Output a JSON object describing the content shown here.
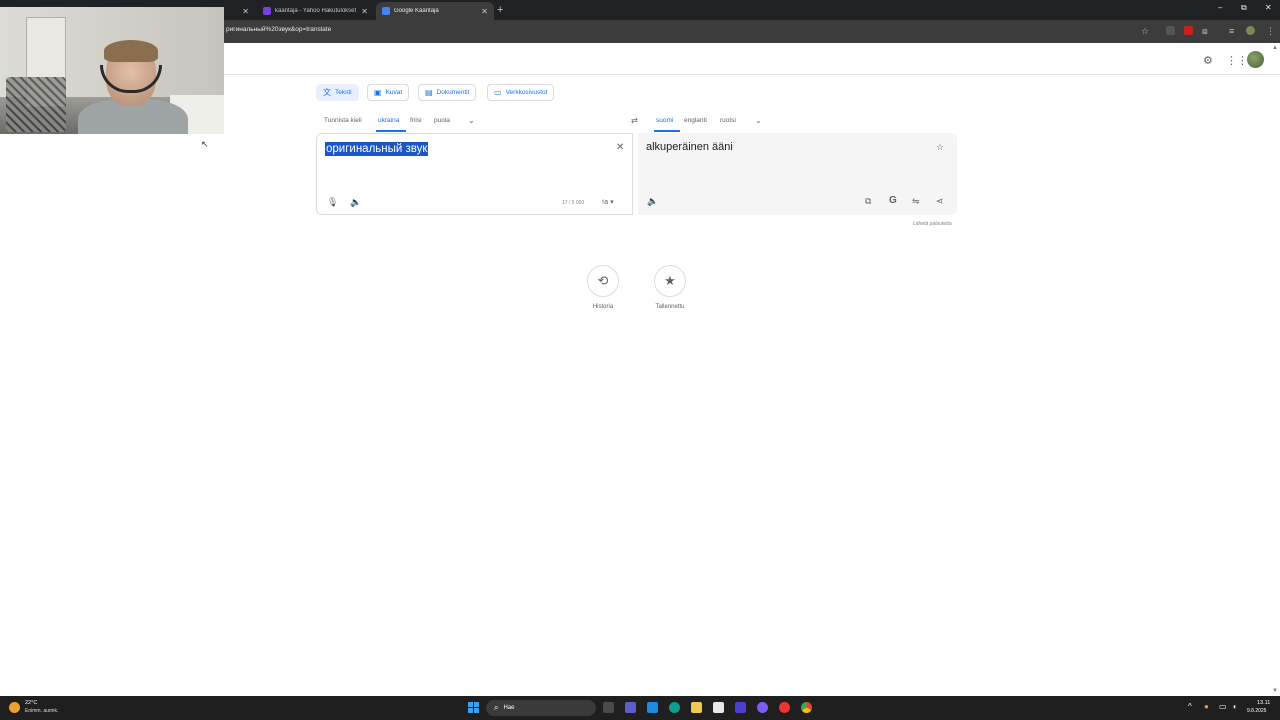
{
  "browser": {
    "tabs": [
      {
        "title": "",
        "active": false
      },
      {
        "title": "kääntäjä - Yahoo Hakutulokset",
        "active": false
      },
      {
        "title": "Google Kääntäjä",
        "active": true
      }
    ],
    "new_tab": "+",
    "url": "ригинальный%20звук&op=translate",
    "window_controls": {
      "minimize": "–",
      "restore": "⧉",
      "close": "✕"
    }
  },
  "modes": [
    {
      "label": "Teksti",
      "icon": "translate-icon",
      "active": true
    },
    {
      "label": "Kuvat",
      "icon": "image-icon",
      "active": false
    },
    {
      "label": "Dokumentit",
      "icon": "document-icon",
      "active": false
    },
    {
      "label": "Verkkosivustot",
      "icon": "website-icon",
      "active": false
    }
  ],
  "source_langs": [
    "Tunnista kieli",
    "ukraina",
    "friisi",
    "puola"
  ],
  "source_lang_active": "ukraina",
  "target_langs": [
    "suomi",
    "englanti",
    "ruotsi"
  ],
  "target_lang_active": "suomi",
  "swap_icon": "⇄",
  "source": {
    "text": "оригинальный звук",
    "char_count": "17 / 5 000",
    "clear": "✕"
  },
  "target": {
    "text": "alkuperäinen ääni"
  },
  "feedback": "Lähetä palautetta",
  "history_label": "Historia",
  "saved_label": "Tallennettu",
  "taskbar": {
    "weather_temp": "22°C",
    "weather_desc": "Enimm. aurink.",
    "search_placeholder": "Hae",
    "time": "13.11",
    "date": "9.8.2025"
  },
  "colors": {
    "accent": "#1a73e8",
    "selection": "#1a56c5",
    "chrome_dark": "#202124"
  }
}
